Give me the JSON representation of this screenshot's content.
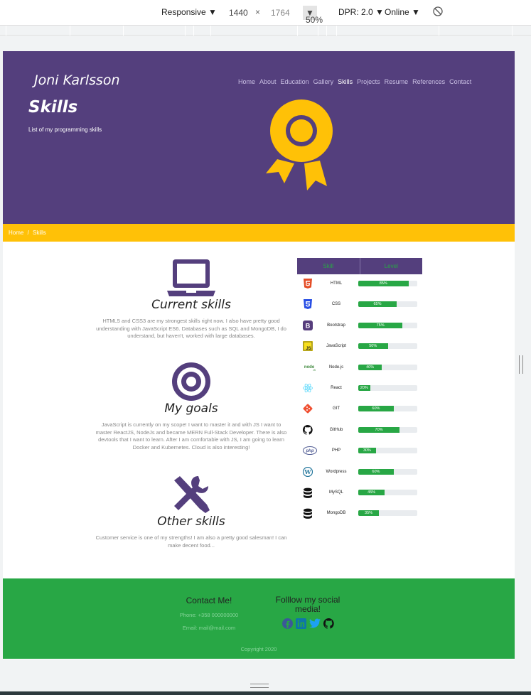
{
  "devtools": {
    "device": "Responsive",
    "width": "1440",
    "times": "×",
    "height": "1764",
    "zoom": "50%",
    "dpr": "DPR: 2.0",
    "network": "Online"
  },
  "header": {
    "brand": "Joni Karlsson",
    "nav": [
      "Home",
      "About",
      "Education",
      "Gallery",
      "Skills",
      "Projects",
      "Resume",
      "References",
      "Contact"
    ],
    "active_nav": "Skills",
    "title": "Skills",
    "subtitle": "List of my programming skills"
  },
  "breadcrumb": {
    "home": "Home",
    "sep": "/",
    "current": "Skills"
  },
  "sections": [
    {
      "heading": "Current skills",
      "text": "HTML5 and CSS3 are my strongest skills right now. I also have pretty good understanding with JavaScript ES6. Databases such as SQL and MongoDB, I do understand, but haven't, worked with large databases."
    },
    {
      "heading": "My goals",
      "text": "JavaScript is currently on my scope! I want to master it and with JS I want to master ReactJS, NodeJs and became MERN Full-Stack Developer. There is also devtools that I want to learn. After I am comfortable with JS, I am going to learn Docker and Kubernetes. Cloud is also interesting!"
    },
    {
      "heading": "Other skills",
      "text": "Customer service is one of my strengths! I am also a pretty good salesman! I can make decent food..."
    }
  ],
  "skills_table": {
    "col_skill": "Skill",
    "col_level": "Level",
    "rows": [
      {
        "name": "HTML",
        "level": 85,
        "label": "85%",
        "icon": "html5-icon",
        "color": "#e44d26"
      },
      {
        "name": "CSS",
        "level": 65,
        "label": "65%",
        "icon": "css3-icon",
        "color": "#264de4"
      },
      {
        "name": "Bootstrap",
        "level": 75,
        "label": "75%",
        "icon": "bootstrap-icon",
        "color": "#563d7c"
      },
      {
        "name": "JavaScript",
        "level": 50,
        "label": "50%",
        "icon": "javascript-icon",
        "color": "#f7df1e"
      },
      {
        "name": "Node.js",
        "level": 40,
        "label": "40%",
        "icon": "nodejs-icon",
        "color": "#3c873a"
      },
      {
        "name": "React",
        "level": 20,
        "label": "20%",
        "icon": "react-icon",
        "color": "#61dafb"
      },
      {
        "name": "GIT",
        "level": 60,
        "label": "60%",
        "icon": "git-icon",
        "color": "#f05032"
      },
      {
        "name": "GitHub",
        "level": 70,
        "label": "70%",
        "icon": "github-icon",
        "color": "#111111"
      },
      {
        "name": "PHP",
        "level": 30,
        "label": "30%",
        "icon": "php-icon",
        "color": "#4f5b93"
      },
      {
        "name": "Wordpress",
        "level": 60,
        "label": "60%",
        "icon": "wordpress-icon",
        "color": "#21759b"
      },
      {
        "name": "MySQL",
        "level": 45,
        "label": "45%",
        "icon": "mysql-icon",
        "color": "#111111"
      },
      {
        "name": "MongoDB",
        "level": 35,
        "label": "35%",
        "icon": "mongodb-icon",
        "color": "#111111"
      }
    ]
  },
  "footer": {
    "contact_title": "Contact Me!",
    "phone": "Phone: +358 000000000",
    "email": "Email: mail@mail.com",
    "social_title": "Folllow my social media!",
    "social_icons": [
      "facebook-icon",
      "linkedin-icon",
      "twitter-icon",
      "github-icon"
    ],
    "copyright": "Copyright 2020"
  },
  "colors": {
    "purple": "#543f7d",
    "yellow": "#ffc107",
    "green": "#28a745"
  }
}
